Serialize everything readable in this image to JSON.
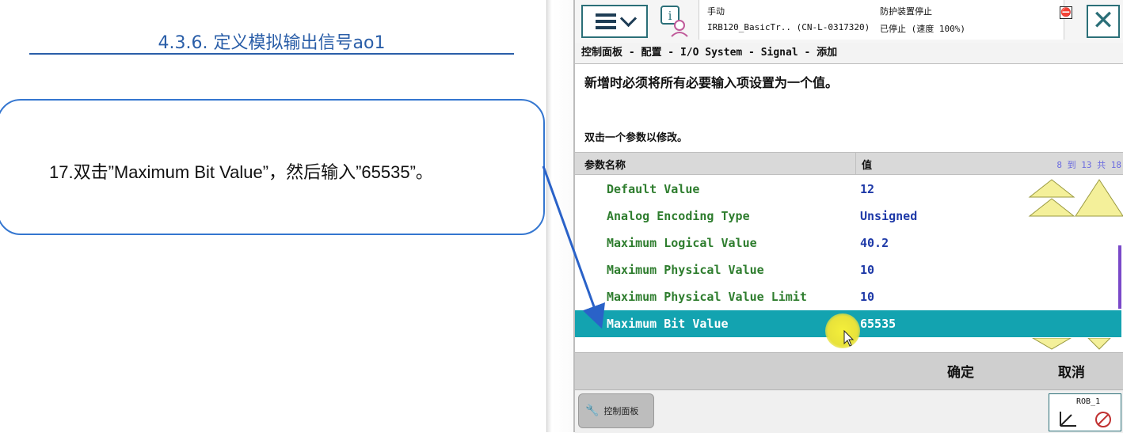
{
  "slide": {
    "title": "4.3.6. 定义模拟输出信号ao1",
    "instruction": "17.双击”Maximum Bit Value”，然后输入”65535”。"
  },
  "pendant": {
    "status": {
      "mode": "手动",
      "controller": "IRB120_BasicTr.. (CN-L-0317320)",
      "protect": "防护装置停止",
      "state": "已停止 (速度 100%)"
    },
    "breadcrumb": "控制面板 - 配置 - I/O System - Signal - 添加",
    "instruction_main": "新增时必须将所有必要输入项设置为一个值。",
    "instruction_sub": "双击一个参数以修改。",
    "table": {
      "col_name": "参数名称",
      "col_value": "值",
      "count": "8 到 13 共 18",
      "rows": [
        {
          "name": "Default Value",
          "value": "12"
        },
        {
          "name": "Analog Encoding Type",
          "value": "Unsigned"
        },
        {
          "name": "Maximum Logical Value",
          "value": "40.2"
        },
        {
          "name": "Maximum Physical Value",
          "value": "10"
        },
        {
          "name": "Maximum Physical Value Limit",
          "value": "10"
        },
        {
          "name": "Maximum Bit Value",
          "value": "65535"
        }
      ]
    },
    "footer": {
      "ok": "确定",
      "cancel": "取消"
    },
    "taskbar": {
      "control_panel": "控制面板",
      "rob_label": "ROB_1"
    }
  }
}
